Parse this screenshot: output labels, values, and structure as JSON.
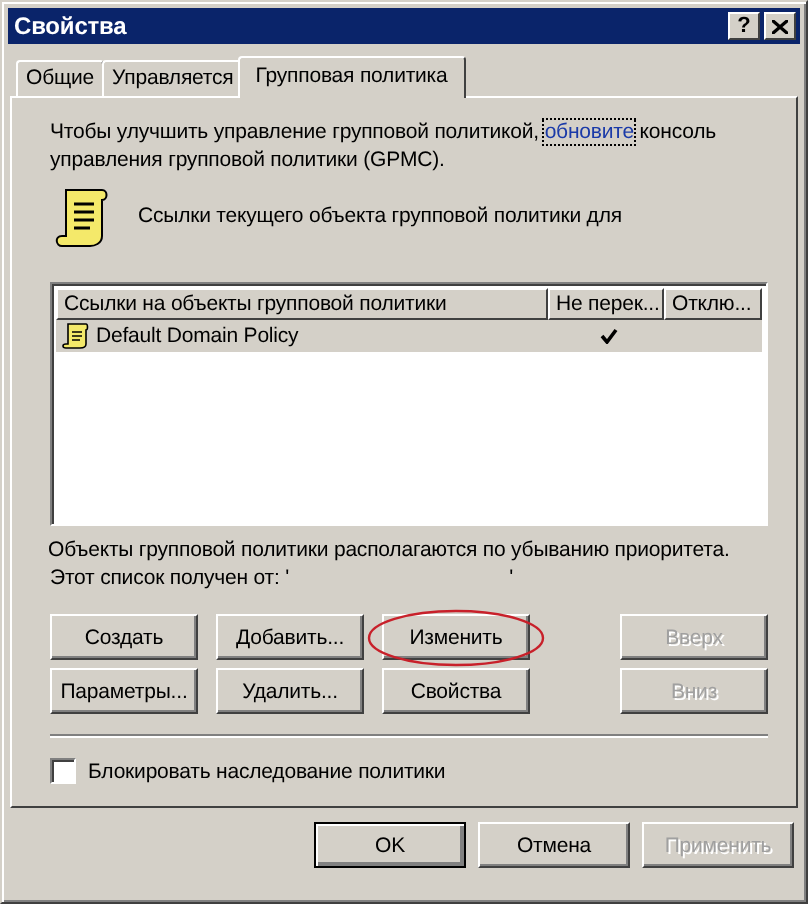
{
  "window": {
    "title": "Свойства",
    "help_label": "?"
  },
  "tabs": [
    {
      "label": "Общие",
      "selected": false
    },
    {
      "label": "Управляется",
      "selected": false
    },
    {
      "label": "Групповая политика",
      "selected": true
    }
  ],
  "upgrade_notice": {
    "before": "Чтобы улучшить управление групповой политикой,",
    "link": "обновите",
    "after": "консоль управления групповой политики (GPMC)."
  },
  "links_caption": "Ссылки текущего объекта групповой политики для",
  "list": {
    "columns": [
      "Ссылки на объекты групповой политики",
      "Не перек...",
      "Отклю..."
    ],
    "rows": [
      {
        "name": "Default Domain Policy",
        "no_override": true,
        "disabled": false,
        "selected": true
      }
    ]
  },
  "order_note": "Объекты групповой политики располагаются по убыванию приоритета.",
  "source": {
    "prefix": "Этот список получен от: '",
    "suffix": "'"
  },
  "buttons": [
    {
      "label": "Создать",
      "disabled": false,
      "circled": false
    },
    {
      "label": "Добавить...",
      "disabled": false,
      "circled": false
    },
    {
      "label": "Изменить",
      "disabled": false,
      "circled": true
    },
    {
      "label": "Вверх",
      "disabled": true,
      "circled": false
    },
    {
      "label": "Параметры...",
      "disabled": false,
      "circled": false
    },
    {
      "label": "Удалить...",
      "disabled": false,
      "circled": false
    },
    {
      "label": "Свойства",
      "disabled": false,
      "circled": false
    },
    {
      "label": "Вниз",
      "disabled": true,
      "circled": false
    }
  ],
  "block_inheritance": {
    "label": "Блокировать наследование политики",
    "checked": false
  },
  "footer_buttons": [
    {
      "label": "OK",
      "default": true,
      "disabled": false
    },
    {
      "label": "Отмена",
      "default": false,
      "disabled": false
    },
    {
      "label": "Применить",
      "default": false,
      "disabled": true
    }
  ]
}
